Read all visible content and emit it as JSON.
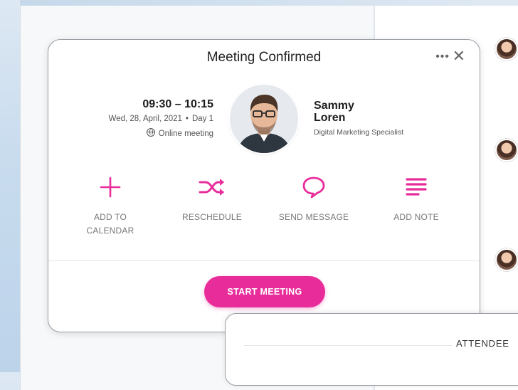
{
  "card": {
    "title": "Meeting Confirmed",
    "more_glyph": "•••",
    "close_glyph": "✕"
  },
  "meeting": {
    "time": "09:30 – 10:15",
    "date": "Wed, 28, April, 2021",
    "separator": "•",
    "day": "Day 1",
    "type": "Online meeting"
  },
  "person": {
    "first_name": "Sammy",
    "last_name": "Loren",
    "role": "Digital Marketing Specialist"
  },
  "actions": [
    {
      "label_line1": "ADD TO",
      "label_line2": "CALENDAR",
      "icon": "plus-icon"
    },
    {
      "label_line1": "RESCHEDULE",
      "label_line2": "",
      "icon": "shuffle-icon"
    },
    {
      "label_line1": "SEND MESSAGE",
      "label_line2": "",
      "icon": "speech-bubble-icon"
    },
    {
      "label_line1": "ADD NOTE",
      "label_line2": "",
      "icon": "note-lines-icon"
    }
  ],
  "primary_button": {
    "label": "START MEETING"
  },
  "attendees": {
    "title": "ATTENDEE"
  },
  "colors": {
    "accent": "#e82d9b",
    "text": "#1d1d1d",
    "muted": "#777777"
  }
}
